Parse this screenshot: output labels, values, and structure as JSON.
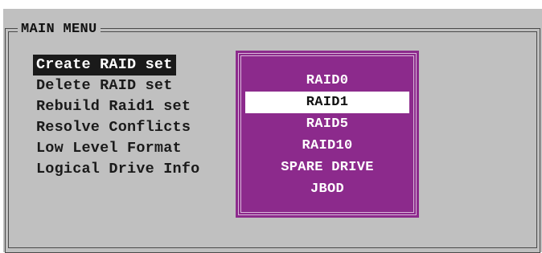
{
  "menu": {
    "title": "MAIN MENU",
    "items": [
      {
        "label": "Create RAID set"
      },
      {
        "label": "Delete RAID set"
      },
      {
        "label": "Rebuild Raid1 set"
      },
      {
        "label": "Resolve Conflicts"
      },
      {
        "label": "Low Level Format"
      },
      {
        "label": "Logical Drive Info"
      }
    ],
    "selected_index": 0
  },
  "raid_popup": {
    "options": [
      {
        "label": "RAID0"
      },
      {
        "label": "RAID1"
      },
      {
        "label": "RAID5"
      },
      {
        "label": "RAID10"
      },
      {
        "label": "SPARE DRIVE"
      },
      {
        "label": "JBOD"
      }
    ],
    "selected_index": 1
  },
  "colors": {
    "panel": "#c0c0c0",
    "popup": "#8c2a8c",
    "text": "#1a1a1a"
  }
}
